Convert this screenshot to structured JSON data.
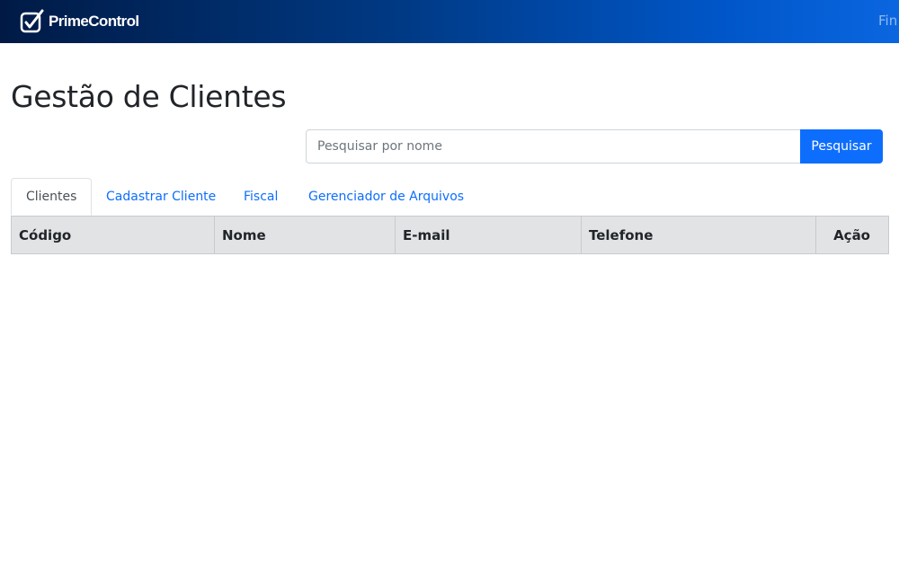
{
  "navbar": {
    "logo_text": "PrimeControl",
    "logo_icon": "checkbox-pen-icon",
    "link_partial": "Fin"
  },
  "page": {
    "title": "Gestão de Clientes"
  },
  "search": {
    "placeholder": "Pesquisar por nome",
    "value": "",
    "button_label": "Pesquisar"
  },
  "tabs": [
    {
      "label": "Clientes",
      "active": true
    },
    {
      "label": "Cadastrar Cliente",
      "active": false
    },
    {
      "label": "Fiscal",
      "active": false
    },
    {
      "label": "Gerenciador de Arquivos",
      "active": false
    }
  ],
  "table": {
    "columns": [
      "Código",
      "Nome",
      "E-mail",
      "Telefone",
      "Ação"
    ],
    "rows": []
  },
  "colors": {
    "navbar_gradient_start": "#001a45",
    "navbar_gradient_end": "#0a66e0",
    "primary": "#0d6efd",
    "table_header_bg": "#e2e3e5"
  }
}
